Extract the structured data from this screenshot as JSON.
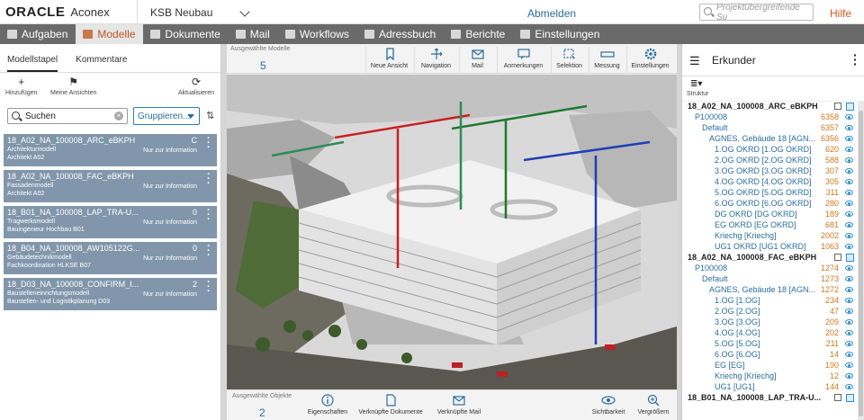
{
  "topbar": {
    "logo_oracle": "ORACLE",
    "logo_aconex": "Aconex",
    "project": "KSB Neubau",
    "logout": "Abmelden",
    "search_placeholder": "Projektübergreifende Su",
    "help": "Hilfe"
  },
  "nav": [
    {
      "label": "Aufgaben",
      "icon": "check-icon"
    },
    {
      "label": "Modelle",
      "icon": "cube-icon",
      "active": true
    },
    {
      "label": "Dokumente",
      "icon": "document-icon"
    },
    {
      "label": "Mail",
      "icon": "mail-icon"
    },
    {
      "label": "Workflows",
      "icon": "workflow-icon"
    },
    {
      "label": "Adressbuch",
      "icon": "addressbook-icon"
    },
    {
      "label": "Berichte",
      "icon": "chart-icon"
    },
    {
      "label": "Einstellungen",
      "icon": "gear-icon"
    }
  ],
  "left": {
    "tabs": [
      "Modellstapel",
      "Kommentare"
    ],
    "tools": {
      "add": "Hinzufügen",
      "views": "Meine Ansichten",
      "refresh": "Aktualisieren"
    },
    "search_value": "Suchen",
    "group_label": "Gruppieren...",
    "models": [
      {
        "name": "18_A02_NA_100008_ARC_eBKPH",
        "type": "Architekturmodell",
        "org": "Architekt A02",
        "count": "C",
        "info": "Nur zur Information"
      },
      {
        "name": "18_A02_NA_100008_FAC_eBKPH",
        "type": "Fassadenmodell",
        "org": "Architekt A02",
        "count": "",
        "info": "Nur zur Information"
      },
      {
        "name": "18_B01_NA_100008_LAP_TRA-U...",
        "type": "Tragwerksmodell",
        "org": "Bauingenieur Hochbau B01",
        "count": "0",
        "info": "Nur zur Information"
      },
      {
        "name": "18_B04_NA_100008_AW105122G...",
        "type": "Gebäudetechnikmodell",
        "org": "Fachkoordination HLKSE B07",
        "count": "0",
        "info": "Nur zur Information"
      },
      {
        "name": "18_D03_NA_100008_CONFIRM_I...",
        "type": "Baustelleneinrichtungsmodell",
        "org": "Baustellen- und Logistikplanung D03",
        "count": "2",
        "info": "Nur zur Information"
      }
    ]
  },
  "viewer": {
    "selected_models_label": "Ausgewählte Modelle",
    "selected_models_value": "5",
    "tools": [
      "Neue Ansicht",
      "Navigation",
      "Mail",
      "Anmerkungen",
      "Selektion",
      "Messung",
      "Einstellungen"
    ],
    "selected_objects_label": "Ausgewählte Objekte",
    "selected_objects_value": "2",
    "bottom_tools": [
      "Eigenschaften",
      "Verknüpfte Dokumente",
      "Verknüpfte Mail",
      "Sichtbarkeit",
      "Vergrößern"
    ]
  },
  "right": {
    "title": "Erkunder",
    "structure_label": "Struktur",
    "tree": [
      {
        "label": "18_A02_NA_100008_ARC_eBKPH",
        "count": "",
        "level": 0,
        "kind": "top"
      },
      {
        "label": "P100008",
        "count": "6358",
        "level": 1,
        "kind": "sub"
      },
      {
        "label": "Default",
        "count": "6357",
        "level": 2,
        "kind": "sub"
      },
      {
        "label": "AGNES, Gebäude 18 [AGN...",
        "count": "6356",
        "level": 3,
        "kind": "sub"
      },
      {
        "label": "1.OG OKRD [1.OG OKRD]",
        "count": "620",
        "level": 4,
        "kind": "sub"
      },
      {
        "label": "2.OG OKRD [2.OG OKRD]",
        "count": "588",
        "level": 4,
        "kind": "sub"
      },
      {
        "label": "3.OG OKRD [3.OG OKRD]",
        "count": "307",
        "level": 4,
        "kind": "sub"
      },
      {
        "label": "4.OG OKRD [4.OG OKRD]",
        "count": "305",
        "level": 4,
        "kind": "sub"
      },
      {
        "label": "5.OG OKRD [5.OG OKRD]",
        "count": "311",
        "level": 4,
        "kind": "sub"
      },
      {
        "label": "6.OG OKRD [6.OG OKRD]",
        "count": "280",
        "level": 4,
        "kind": "sub"
      },
      {
        "label": "DG OKRD [DG OKRD]",
        "count": "189",
        "level": 4,
        "kind": "sub"
      },
      {
        "label": "EG OKRD [EG OKRD]",
        "count": "681",
        "level": 4,
        "kind": "sub"
      },
      {
        "label": "Kriechg [Kriechg]",
        "count": "2002",
        "level": 4,
        "kind": "sub"
      },
      {
        "label": "UG1 OKRD [UG1 OKRD]",
        "count": "1063",
        "level": 4,
        "kind": "sub"
      },
      {
        "label": "18_A02_NA_100008_FAC_eBKPH",
        "count": "",
        "level": 0,
        "kind": "top"
      },
      {
        "label": "P100008",
        "count": "1274",
        "level": 1,
        "kind": "sub"
      },
      {
        "label": "Default",
        "count": "1273",
        "level": 2,
        "kind": "sub"
      },
      {
        "label": "AGNES, Gebäude 18 [AGN...",
        "count": "1272",
        "level": 3,
        "kind": "sub"
      },
      {
        "label": "1.OG [1.OG]",
        "count": "234",
        "level": 4,
        "kind": "sub"
      },
      {
        "label": "2.OG [2.OG]",
        "count": "47",
        "level": 4,
        "kind": "sub"
      },
      {
        "label": "3.OG [3.OG]",
        "count": "209",
        "level": 4,
        "kind": "sub"
      },
      {
        "label": "4.OG [4.OG]",
        "count": "202",
        "level": 4,
        "kind": "sub"
      },
      {
        "label": "5.OG [5.OG]",
        "count": "211",
        "level": 4,
        "kind": "sub"
      },
      {
        "label": "6.OG [6.OG]",
        "count": "14",
        "level": 4,
        "kind": "sub"
      },
      {
        "label": "EG [EG]",
        "count": "190",
        "level": 4,
        "kind": "sub"
      },
      {
        "label": "Kriechg [Kriechg]",
        "count": "12",
        "level": 4,
        "kind": "sub"
      },
      {
        "label": "UG1 [UG1]",
        "count": "144",
        "level": 4,
        "kind": "sub"
      },
      {
        "label": "18_B01_NA_100008_LAP_TRA-U...",
        "count": "",
        "level": 0,
        "kind": "top"
      }
    ]
  },
  "colors": {
    "accent": "#c0571e",
    "link": "#2a6f9e",
    "card": "#8196ab",
    "nav": "#6a6a6a",
    "count": "#d2781e"
  }
}
